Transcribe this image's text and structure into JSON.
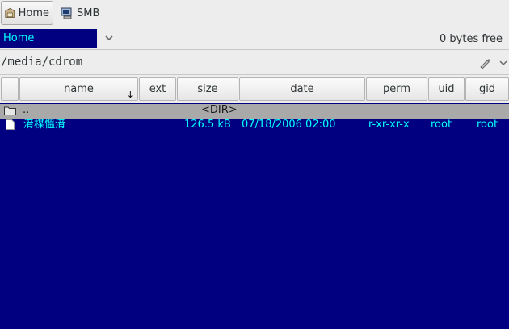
{
  "toolbar": {
    "home_label": "Home",
    "smb_label": "SMB",
    "home_icon": "home-folder-icon",
    "smb_icon": "network-computer-icon"
  },
  "drive": {
    "selected": "Home",
    "free_space": "0 bytes free"
  },
  "path": {
    "current": "/media/cdrom"
  },
  "columns": {
    "name": "name",
    "ext": "ext",
    "size": "size",
    "date": "date",
    "perm": "perm",
    "uid": "uid",
    "gid": "gid",
    "sort_indicator": "↓"
  },
  "rows": [
    {
      "name": "..",
      "size": "<DIR>"
    },
    {
      "name": "湇楳慍湇",
      "size": "126.5 kB",
      "date": "07/18/2006 02:00",
      "perm": "r-xr-xr-x",
      "uid": "root",
      "gid": "root"
    }
  ],
  "colors": {
    "panel_bg": "#000080",
    "file_text": "#00ffff",
    "updir_bg": "#a9a9a9"
  }
}
